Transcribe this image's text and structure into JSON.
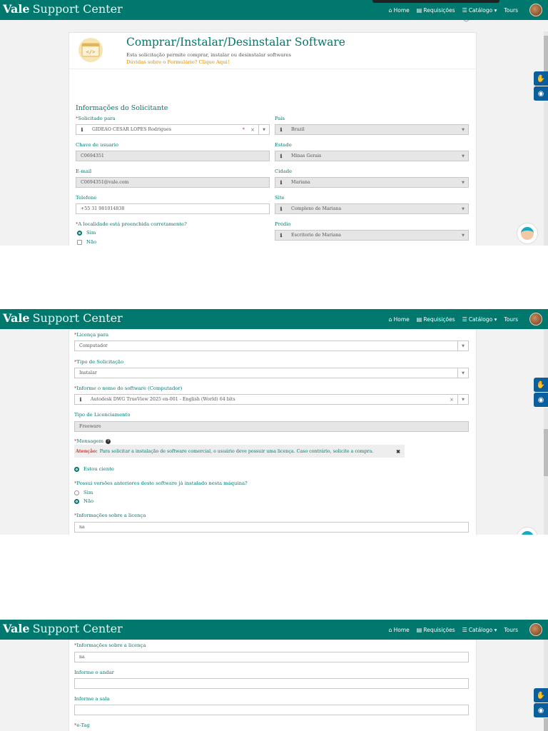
{
  "app": {
    "brand_bold": "Vale",
    "brand_rest": "Support Center"
  },
  "nav": {
    "home": "Home",
    "requests": "Requisições",
    "catalog": "Catálogo ▾",
    "tours": "Tours"
  },
  "header": {
    "title": "Comprar/Instalar/Desinstalar Software",
    "description": "Esta solicitação permite comprar, instalar ou desinstalar softwares",
    "help_link": "Dúvidas sobre o Formulário? Clique Aqui!"
  },
  "requester": {
    "section_title": "Informações do Solicitante",
    "requested_for_label": "Solicitado para",
    "requested_for_value": "GIDEÃO CESAR LOPES Rodrigues",
    "country_label": "País",
    "country_value": "Brazil",
    "user_key_label": "Chave de usuario",
    "user_key_value": "C0694351",
    "state_label": "Estado",
    "state_value": "Minas Gerais",
    "email_label": "E-mail",
    "email_value": "C0694351@vale.com",
    "city_label": "Cidade",
    "city_value": "Mariana",
    "phone_label": "Telefone",
    "phone_value": "+55 31 981014838",
    "site_label": "Site",
    "site_value": "Complexo de Mariana",
    "location_question": "A localidade está preenchida corretamente?",
    "location_yes": "Sim",
    "location_no": "Não",
    "building_label": "Prédio",
    "building_value": "Escritorio de Mariana"
  },
  "software": {
    "license_for_label": "Licença para",
    "license_for_value": "Computador",
    "request_type_label": "Tipo de Solicitação",
    "request_type_value": "Instalar",
    "software_name_label": "Informe o nome do software (Computador)",
    "software_name_value": "Autodesk DWG TrueView 2025 en-001 - English (World) 64 bits",
    "licensing_type_label": "Tipo de Licenciamento",
    "licensing_type_value": "Freeware",
    "message_label": "Mensagem",
    "alert_prefix": "Atenção:",
    "alert_text": "Para solicitar a instalação de software comercial, o usuário deve possuir uma licença. Caso contrário, solicite a compra.",
    "aware_label": "Estou ciente",
    "previous_versions_question": "Possui versões anteriores deste software já instalado nesta máquina?",
    "previous_yes": "Sim",
    "previous_no": "Não",
    "license_info_label": "Informações sobre a licença",
    "license_info_value": "na"
  },
  "location": {
    "floor_label": "Informe o andar",
    "floor_value": "",
    "room_label": "Informe a sala",
    "room_value": "",
    "etag_label": "e-Tag"
  },
  "colors": {
    "brand": "#00786e",
    "accent_link": "#e08a00",
    "side_buttons": "#0a5e9c",
    "required": "#d33333"
  }
}
